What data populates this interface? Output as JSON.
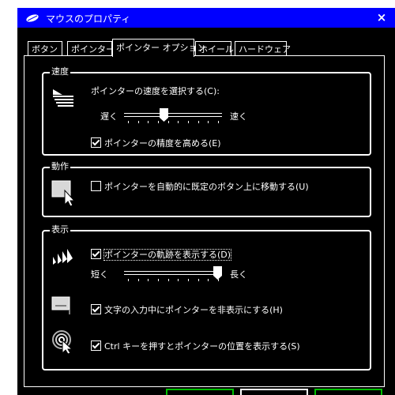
{
  "window": {
    "title": "マウスのプロパティ",
    "close_glyph": "×"
  },
  "tabs": [
    {
      "label": "ボタン",
      "active": false
    },
    {
      "label": "ポインター",
      "active": false
    },
    {
      "label": "ポインター オプション",
      "active": true
    },
    {
      "label": "ホイール",
      "active": false
    },
    {
      "label": "ハードウェア",
      "active": false
    }
  ],
  "speed": {
    "group_label": "速度",
    "select_label": "ポインターの速度を選択する(C):",
    "slow_label": "遅く",
    "fast_label": "速く",
    "slider_value": 0.4,
    "precision_label": "ポインターの精度を高める(E)",
    "precision_checked": true
  },
  "snap": {
    "group_label": "動作",
    "snap_label": "ポインターを自動的に既定のボタン上に移動する(U)",
    "snap_checked": false
  },
  "visibility": {
    "group_label": "表示",
    "trails_label": "ポインターの軌跡を表示する(D)",
    "trails_checked": true,
    "short_label": "短く",
    "long_label": "長く",
    "trails_value": 1.0,
    "hide_typing_label": "文字の入力中にポインターを非表示にする(H)",
    "hide_typing_checked": true,
    "ctrl_label": "Ctrl キーを押すとポインターの位置を表示する(S)",
    "ctrl_checked": true
  },
  "colors": {
    "title_bar": "#0000ff",
    "background": "#000000",
    "foreground": "#ffffff",
    "default_button": "#00c000"
  },
  "icons": {
    "title": "mouse-icon",
    "speed": "pointer-speed-icon",
    "snap": "snap-to-icon",
    "trails": "pointer-trails-icon",
    "hide": "hide-pointer-icon",
    "ctrl": "ctrl-locate-icon"
  }
}
